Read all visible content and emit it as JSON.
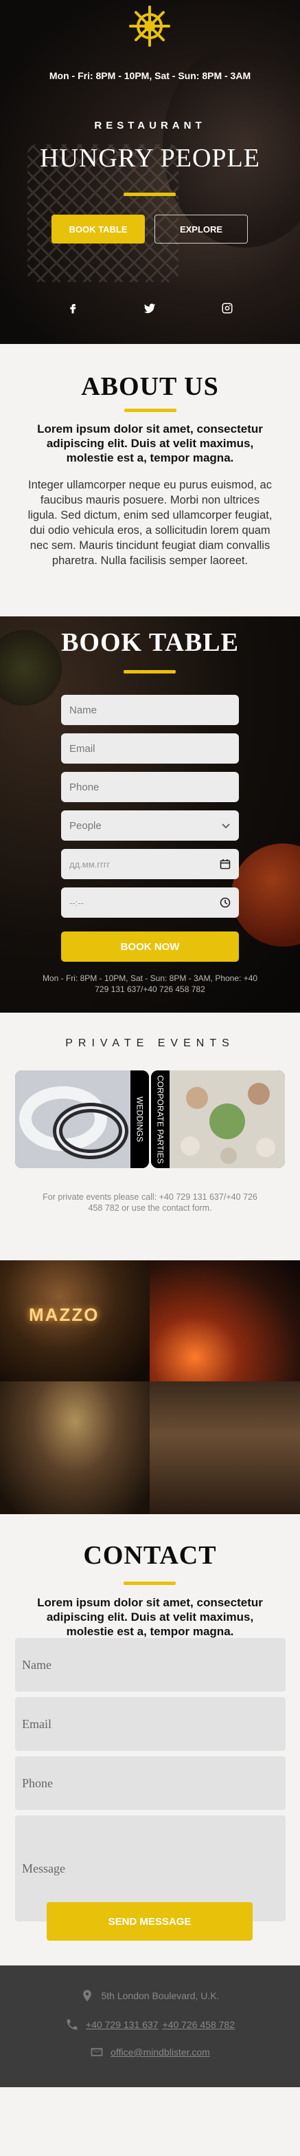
{
  "hero": {
    "hours": "Mon - Fri: 8PM - 10PM, Sat - Sun: 8PM - 3AM",
    "kicker": "RESTAURANT",
    "brand": "HUNGRY PEOPLE",
    "book_button": "BOOK TABLE",
    "explore_button": "EXPLORE",
    "social": [
      "facebook-icon",
      "twitter-icon",
      "instagram-icon"
    ]
  },
  "about": {
    "title": "ABOUT US",
    "lead": "Lorem ipsum dolor sit amet, consectetur adipiscing elit. Duis at velit maximus, molestie est a, tempor magna.",
    "body": "Integer ullamcorper neque eu purus euismod, ac faucibus mauris posuere. Morbi non ultrices ligula. Sed dictum, enim sed ullamcorper feugiat, dui odio vehicula eros, a sollicitudin lorem quam nec sem. Mauris tincidunt feugiat diam convallis pharetra. Nulla facilisis semper laoreet."
  },
  "book": {
    "title": "BOOK TABLE",
    "name_placeholder": "Name",
    "email_placeholder": "Email",
    "phone_placeholder": "Phone",
    "people_placeholder": "People",
    "date_placeholder": "дд.мм.гггг",
    "time_placeholder": "--:--",
    "submit": "BOOK NOW",
    "note": "Mon - Fri: 8PM - 10PM, Sat - Sun: 8PM - 3AM, Phone: +40 729 131 637/+40 726 458 782"
  },
  "events": {
    "kicker": "PRIVATE EVENTS",
    "cards": [
      "WEDDINGS",
      "CORPORATE PARTIES"
    ],
    "note": "For private events please call: +40 729 131 637/+40 726 458 782 or use the contact form."
  },
  "gallery": {
    "sign": "MAZZO"
  },
  "contact": {
    "title": "CONTACT",
    "lead": "Lorem ipsum dolor sit amet, consectetur adipiscing elit. Duis at velit maximus, molestie est a, tempor magna.",
    "name_placeholder": "Name",
    "email_placeholder": "Email",
    "phone_placeholder": "Phone",
    "message_placeholder": "Message",
    "submit": "SEND MESSAGE"
  },
  "footer": {
    "address": "5th London Boulevard, U.K.",
    "phone1": "+40 729 131 637",
    "phone2": "+40 726 458 782",
    "email": "office@mindblister.com"
  },
  "colors": {
    "accent": "#e8c10b",
    "footer_bg": "#3c3c3c",
    "page_bg": "#f5f3f2"
  }
}
